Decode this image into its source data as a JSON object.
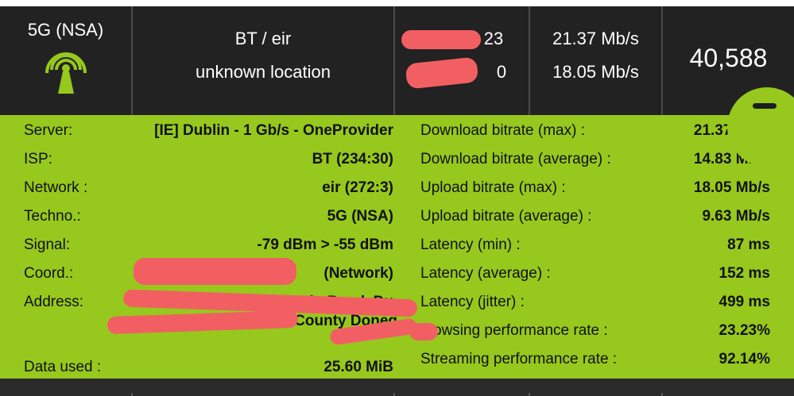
{
  "header": {
    "techno": "5G (NSA)",
    "operator_line1": "BT / eir",
    "operator_line2": "unknown location",
    "date_line1_fragment": "23",
    "date_line2_fragment": "0",
    "download_rate": "21.37 Mb/s",
    "upload_rate": "18.05 Mb/s",
    "score": "40,588",
    "signal_icon": "antenna-icon",
    "accent_color": "#97c81e"
  },
  "details_left": [
    {
      "label": "Server:",
      "value": "[IE] Dublin - 1 Gb/s - OneProvider"
    },
    {
      "label": "ISP:",
      "value": "BT (234:30)"
    },
    {
      "label": "Network :",
      "value": "eir (272:3)"
    },
    {
      "label": "Techno.:",
      "value": "5G (NSA)"
    },
    {
      "label": "Signal:",
      "value": "-79 dBm > -55 dBm"
    },
    {
      "label": "Coord.:",
      "value": "(Network)"
    },
    {
      "label": "Address:",
      "value": "Main Road, Du",
      "value2": "ict, County Doneg"
    },
    {
      "label": "Data used :",
      "value": "25.60 MiB"
    }
  ],
  "details_right": [
    {
      "label": "Download bitrate (max) :",
      "value": "21.37 Mb/s"
    },
    {
      "label": "Download bitrate (average) :",
      "value": "14.83 Mb/s"
    },
    {
      "label": "Upload bitrate (max) :",
      "value": "18.05 Mb/s"
    },
    {
      "label": "Upload bitrate (average) :",
      "value": "9.63 Mb/s"
    },
    {
      "label": "Latency (min) :",
      "value": "87 ms"
    },
    {
      "label": "Latency (average) :",
      "value": "152 ms"
    },
    {
      "label": "Latency (jitter) :",
      "value": "499 ms"
    },
    {
      "label": "owsing performance rate :",
      "value": "23.23%"
    },
    {
      "label": "Streaming performance rate :",
      "value": "92.14%"
    }
  ]
}
